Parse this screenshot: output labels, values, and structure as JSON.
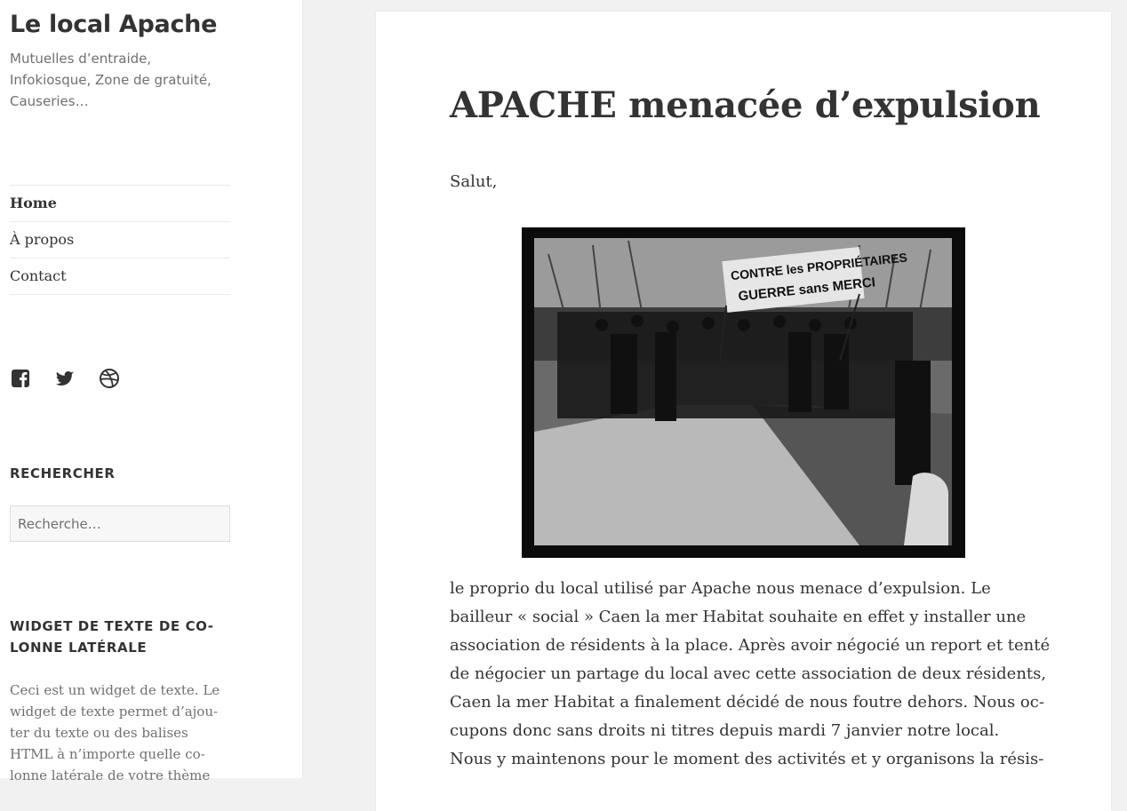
{
  "site": {
    "title": "Le local Apache",
    "description": "Mutuelles d’entraide, Infokiosque, Zone de gratuité, Causeries…"
  },
  "nav": {
    "items": [
      {
        "label": "Home",
        "current": true
      },
      {
        "label": "À propos"
      },
      {
        "label": "Contact"
      }
    ]
  },
  "social": {
    "icons": [
      "facebook-icon",
      "twitter-icon",
      "dribbble-icon"
    ]
  },
  "search_widget": {
    "title": "RECHERCHER",
    "placeholder": "Recherche…"
  },
  "text_widget": {
    "title_lines": [
      "WIDGET DE TEXTE DE CO-",
      "LONNE LATÉRALE"
    ],
    "text": "Ceci est un widget de texte. Le widget de texte permet d’ajou- ter du texte ou des balises HTML à n’importe quelle co- lonne latérale de votre thème"
  },
  "article": {
    "title": "APACHE menacée d’expulsion",
    "greeting": "Salut,",
    "image": {
      "banner_line1": "CONTRE les PROPRIÉTAIRES",
      "banner_line2": "GUERRE sans MERCI"
    },
    "body_lines": [
      "le proprio du local utilisé par Apache nous menace d’expulsion. Le",
      "bailleur « social » Caen la mer Habitat souhaite en effet y installer une",
      "association de résidents à la place. Après avoir négocié un report et tenté",
      "de négocier un partage du local avec cette association de deux résidents,",
      "Caen la mer Habitat a finalement décidé de nous foutre dehors. Nous oc-",
      "cupons donc sans droits ni titres depuis mardi 7 janvier notre local.",
      "Nous y maintenons pour le moment des activités et y organisons la résis-"
    ]
  },
  "colors": {
    "page_bg": "#f1f1f1",
    "text": "#333333",
    "muted": "#707070"
  }
}
